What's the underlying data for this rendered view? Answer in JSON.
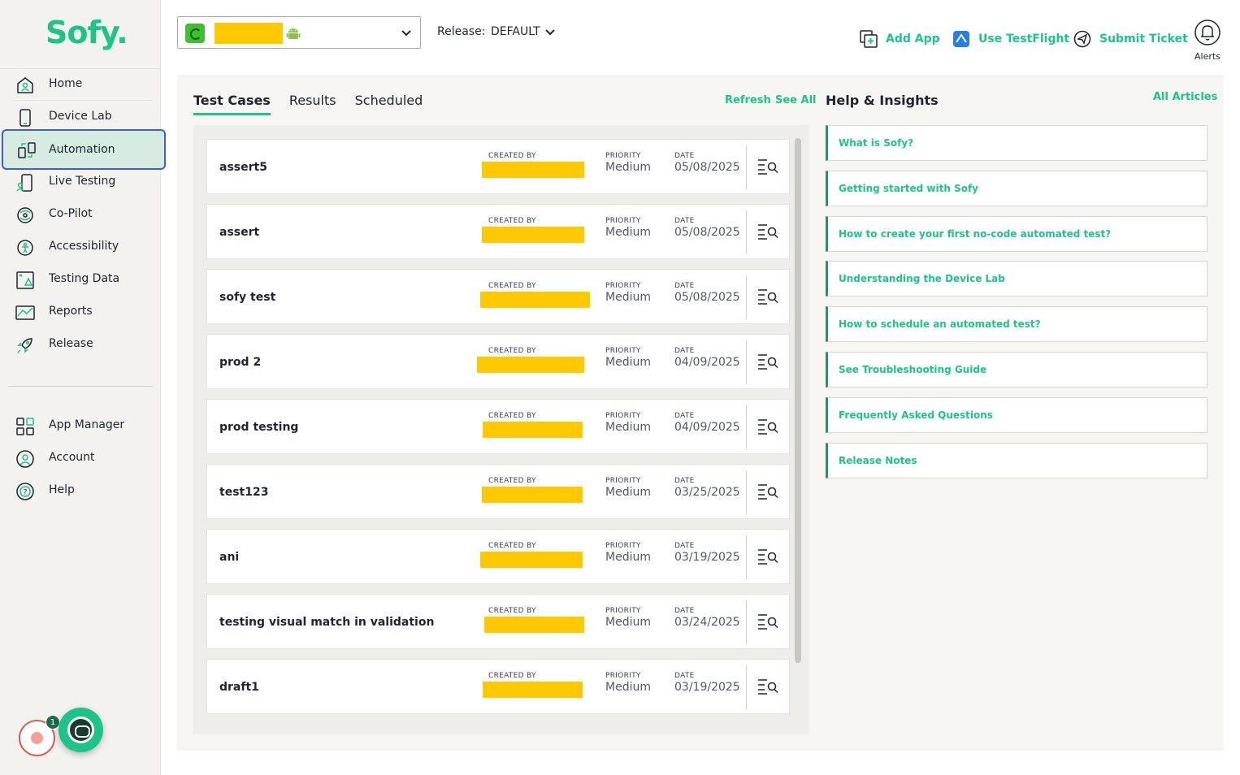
{
  "brand": {
    "logo": "Sofy.",
    "accent": "#1ec38a",
    "highlight": "#3a5de8",
    "redaction": "#ffc800"
  },
  "sidebar": {
    "items": [
      {
        "label": "Home",
        "icon": "home-icon"
      },
      {
        "label": "Device Lab",
        "icon": "device-icon"
      },
      {
        "label": "Automation",
        "icon": "automation-icon",
        "active": true
      },
      {
        "label": "Live Testing",
        "icon": "live-testing-icon"
      },
      {
        "label": "Co-Pilot",
        "icon": "copilot-icon"
      },
      {
        "label": "Accessibility",
        "icon": "accessibility-icon"
      },
      {
        "label": "Testing Data",
        "icon": "testing-data-icon"
      },
      {
        "label": "Reports",
        "icon": "reports-icon"
      },
      {
        "label": "Release",
        "icon": "rocket-icon"
      }
    ],
    "secondary": [
      {
        "label": "App Manager",
        "icon": "grid-icon"
      },
      {
        "label": "Account",
        "icon": "user-icon"
      },
      {
        "label": "Help",
        "icon": "help-icon"
      }
    ],
    "notification_count": "1"
  },
  "topbar": {
    "release_label": "Release:",
    "release_value": "DEFAULT",
    "actions": [
      {
        "label": "Add App",
        "icon": "add-app-icon"
      },
      {
        "label": "Use TestFlight",
        "icon": "testflight-icon"
      },
      {
        "label": "Submit Ticket",
        "icon": "ticket-icon"
      }
    ],
    "alerts_label": "Alerts"
  },
  "tabs": [
    "Test Cases",
    "Results",
    "Scheduled"
  ],
  "list_actions": {
    "refresh": "Refresh",
    "see_all": "See All"
  },
  "columns": {
    "created_by": "CREATED BY",
    "priority": "PRIORITY",
    "date": "DATE"
  },
  "test_cases": [
    {
      "name": "assert5",
      "priority": "Medium",
      "date": "05/08/2025"
    },
    {
      "name": "assert",
      "priority": "Medium",
      "date": "05/08/2025"
    },
    {
      "name": "sofy test",
      "priority": "Medium",
      "date": "05/08/2025"
    },
    {
      "name": "prod 2",
      "priority": "Medium",
      "date": "04/09/2025"
    },
    {
      "name": "prod testing",
      "priority": "Medium",
      "date": "04/09/2025"
    },
    {
      "name": "test123",
      "priority": "Medium",
      "date": "03/25/2025"
    },
    {
      "name": "ani",
      "priority": "Medium",
      "date": "03/19/2025"
    },
    {
      "name": "testing visual match in validation",
      "priority": "Medium",
      "date": "03/24/2025"
    },
    {
      "name": "draft1",
      "priority": "Medium",
      "date": "03/19/2025"
    }
  ],
  "help": {
    "title": "Help & Insights",
    "all_articles": "All Articles",
    "articles": [
      "What is Sofy?",
      "Getting started with Sofy",
      "How to create your first no-code automated test?",
      "Understanding the Device Lab",
      "How to schedule an automated test?",
      "See Troubleshooting Guide",
      "Frequently Asked Questions",
      "Release Notes"
    ]
  }
}
